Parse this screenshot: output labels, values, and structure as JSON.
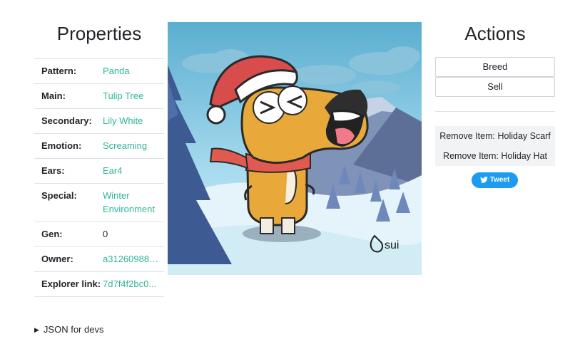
{
  "properties": {
    "title": "Properties",
    "rows": [
      {
        "key": "Pattern:",
        "value": "Panda"
      },
      {
        "key": "Main:",
        "value": "Tulip Tree"
      },
      {
        "key": "Secondary:",
        "value": "Lily White"
      },
      {
        "key": "Emotion:",
        "value": "Screaming"
      },
      {
        "key": "Ears:",
        "value": "Ear4"
      },
      {
        "key": "Special:",
        "value": "Winter Environment"
      },
      {
        "key": "Gen:",
        "value": "0"
      },
      {
        "key": "Owner:",
        "value": "a312609888..."
      },
      {
        "key": "Explorer link:",
        "value": "7d7f4f2bc0..."
      }
    ]
  },
  "image": {
    "watermark": "sui"
  },
  "actions": {
    "title": "Actions",
    "breed_label": "Breed",
    "sell_label": "Sell",
    "items": [
      "Remove Item: Holiday Scarf",
      "Remove Item: Holiday Hat"
    ],
    "tweet_label": "Tweet"
  },
  "footer": {
    "json_label": "JSON for devs"
  },
  "colors": {
    "link": "#2fb59b",
    "tweet": "#1d9bf0"
  }
}
